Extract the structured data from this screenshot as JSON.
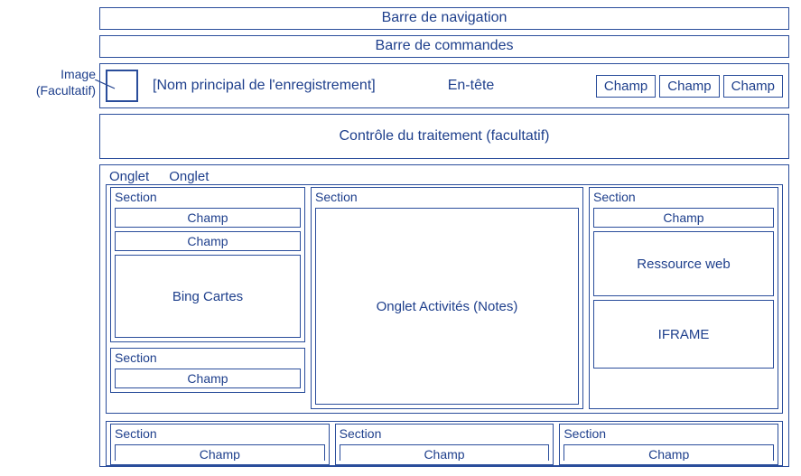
{
  "annotation": {
    "line1": "Image",
    "line2": "(Facultatif)"
  },
  "bars": {
    "nav": "Barre de navigation",
    "cmd": "Barre de commandes"
  },
  "header": {
    "record_name": "[Nom principal de l'enregistrement]",
    "label": "En-tête",
    "fields": [
      "Champ",
      "Champ",
      "Champ"
    ]
  },
  "process": "Contrôle du traitement (facultatif)",
  "tabs": [
    "Onglet",
    "Onglet"
  ],
  "section_label": "Section",
  "field_label": "Champ",
  "blocks": {
    "bing": "Bing Cartes",
    "activities": "Onglet Activités (Notes)",
    "web": "Ressource web",
    "iframe": "IFRAME"
  }
}
